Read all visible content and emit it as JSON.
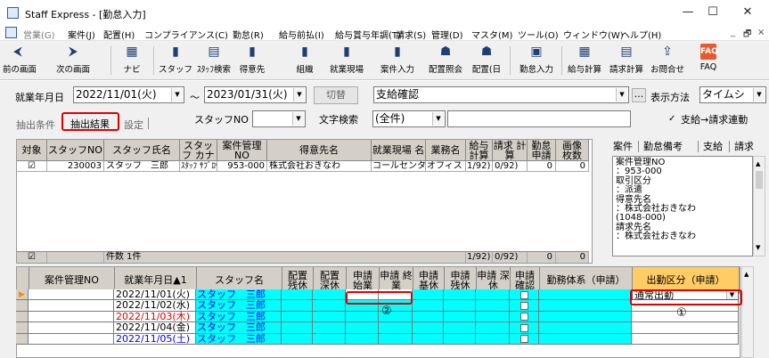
{
  "window": {
    "title": "Staff Express - [勤怠入力]",
    "minimize": "—",
    "maximize": "☐",
    "close": "✕"
  },
  "menu": {
    "items": [
      "営業(G)",
      "案件(J)",
      "配置(H)",
      "コンプライアンス(C)",
      "勤怠(R)",
      "給与前払(I)",
      "給与賞与年調(T)",
      "請求(S)",
      "管理(D)",
      "マスタ(M)",
      "ツール(O)",
      "ウィンドウ(W)",
      "ヘルプ(H)"
    ],
    "mdi": [
      "_",
      "🗗",
      "×"
    ]
  },
  "toolbar": {
    "prev": "前の画面",
    "next": "次の画面",
    "navi": "ナビ",
    "staff": "スタッフ",
    "staff_search": "ｽﾀｯﾌ検索",
    "client": "得意先",
    "org": "組織",
    "site": "就業現場",
    "case_input": "案件入力",
    "assign_view": "配置照会",
    "assign_day": "配置(日",
    "attendance_input": "勤怠入力",
    "pay_calc": "給与計算",
    "bill_calc": "請求計算",
    "contact": "お問合せ",
    "faq": "FAQ",
    "faq_icon_text": "FAQ"
  },
  "filter": {
    "period_label": "就業年月日",
    "date_from": "2022/11/01(火)",
    "tilde": "～",
    "date_to": "2023/01/31(火)",
    "switch_btn": "切替",
    "status": "支給確認",
    "display_method_label": "表示方法",
    "display_method": "タイムシ",
    "staff_no_label": "スタッフNO",
    "staff_no": "",
    "text_search_label": "文字検索",
    "text_search_scope": "(全件)",
    "text_search_value": "",
    "checkbox_label": "支給→請求連動",
    "checkbox_mark": "✓",
    "more_btn": "...",
    "tabs": [
      "抽出条件",
      "抽出結果",
      "設定"
    ]
  },
  "grid1": {
    "headers": [
      "対象",
      "スタッフNO",
      "スタッフ氏名",
      "スタッフ\nカナ",
      "案件管理\nNO",
      "得意先名",
      "就業現場\n名",
      "業務名",
      "給与\n計算",
      "請求\n計算",
      "勤怠\n申請",
      "画像\n枚数"
    ],
    "row": [
      "☑",
      "230003",
      "スタッフ　三郎",
      "ｽﾀｯﾌ ｻﾌﾞﾛｳ",
      "953-000",
      "株式会社おきなわ",
      "コールセンター",
      "オフィス",
      "1/92)",
      "0/92)",
      "0",
      "0"
    ],
    "footer_check": "☑",
    "footer_count": "件数 1件",
    "footer_pay": "1/92)",
    "footer_bill": "0/92)",
    "footer_att": "0",
    "footer_img": "0"
  },
  "right_panel": {
    "tabs": [
      "案件",
      "勤怠備考",
      "支給",
      "請求"
    ],
    "memo": "案件管理NO\n：953-000\n取引区分\n：派遣\n得意先名\n：株式会社おきなわ\n(1048-000)\n請求先名\n：株式会社おきなわ"
  },
  "grid2": {
    "headers": [
      "案件管理NO",
      "就業年月日▲1",
      "スタッフ名",
      "配置\n残休",
      "配置\n深休",
      "申請\n始業",
      "申請\n終業",
      "申請\n基休",
      "申請\n残休",
      "申請\n深休",
      "申請\n確認",
      "勤務体系（申請）",
      "出勤区分（申請）"
    ],
    "rows": [
      {
        "date": "2022/11/01(火)",
        "name": "スタッフ　三郎",
        "date_color": "#000000",
        "kubun": "通常出勤"
      },
      {
        "date": "2022/11/02(水)",
        "name": "スタッフ　三郎",
        "date_color": "#000000",
        "kubun": ""
      },
      {
        "date": "2022/11/03(木)",
        "name": "スタッフ　三郎",
        "date_color": "#e00000",
        "kubun": ""
      },
      {
        "date": "2022/11/04(金)",
        "name": "スタッフ　三郎",
        "date_color": "#000000",
        "kubun": ""
      },
      {
        "date": "2022/11/05(土)",
        "name": "スタッフ　三郎",
        "date_color": "#0000ff",
        "kubun": ""
      }
    ],
    "row_pointer": "▶"
  },
  "annotations": {
    "one": "①",
    "two": "②"
  },
  "colors": {
    "highlight_red": "#e00000",
    "cyan": "#00ffff",
    "header_orange": "#ffcc66",
    "pointer_orange": "#ff8800"
  }
}
